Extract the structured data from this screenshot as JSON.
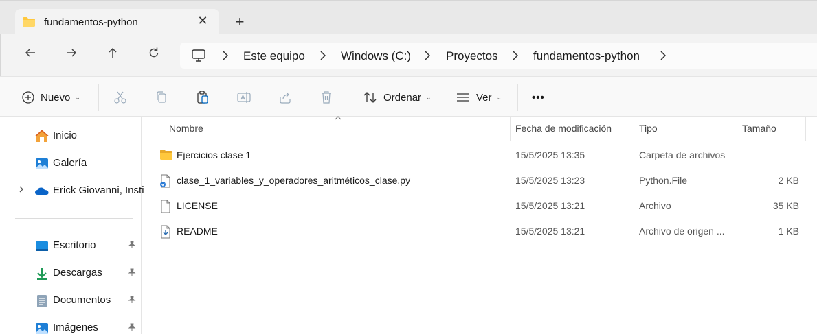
{
  "tab": {
    "title": "fundamentos-python",
    "close": "✕",
    "new_tab": "+"
  },
  "nav": {
    "back": "←",
    "forward": "→",
    "up": "↑",
    "refresh": "↻"
  },
  "breadcrumb": [
    "Este equipo",
    "Windows (C:)",
    "Proyectos",
    "fundamentos-python"
  ],
  "commands": {
    "new_label": "Nuevo",
    "sort_label": "Ordenar",
    "view_label": "Ver",
    "more": "•••",
    "caret": "⌄"
  },
  "sidebar": {
    "items": [
      {
        "label": "Inicio",
        "icon": "home-icon"
      },
      {
        "label": "Galería",
        "icon": "gallery-icon"
      },
      {
        "label": "Erick Giovanni, Insti",
        "icon": "onedrive-icon"
      },
      {
        "label": "Escritorio",
        "icon": "desktop-icon",
        "pinned": true
      },
      {
        "label": "Descargas",
        "icon": "download-icon",
        "pinned": true
      },
      {
        "label": "Documentos",
        "icon": "documents-icon",
        "pinned": true
      },
      {
        "label": "Imágenes",
        "icon": "pictures-icon",
        "pinned": true
      }
    ]
  },
  "columns": {
    "name": "Nombre",
    "modified": "Fecha de modificación",
    "type": "Tipo",
    "size": "Tamaño"
  },
  "files": [
    {
      "name": "Ejercicios clase 1",
      "modified": "15/5/2025 13:35",
      "type": "Carpeta de archivos",
      "size": "",
      "icon": "folder-icon"
    },
    {
      "name": "clase_1_variables_y_operadores_aritméticos_clase.py",
      "modified": "15/5/2025 13:23",
      "type": "Python.File",
      "size": "2 KB",
      "icon": "python-file-icon"
    },
    {
      "name": "LICENSE",
      "modified": "15/5/2025 13:21",
      "type": "Archivo",
      "size": "35 KB",
      "icon": "file-icon"
    },
    {
      "name": "README",
      "modified": "15/5/2025 13:21",
      "type": "Archivo de origen ...",
      "size": "1 KB",
      "icon": "readme-file-icon"
    }
  ],
  "colors": {
    "accent": "#0067c0",
    "folder": "#ffc83d",
    "tabstrip": "#e9e9e9"
  }
}
